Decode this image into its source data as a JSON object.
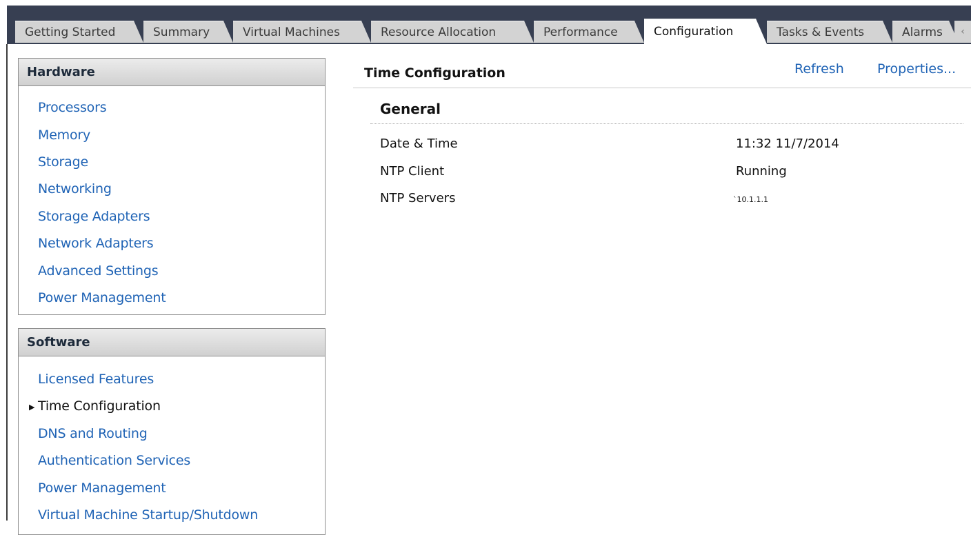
{
  "tabs": [
    {
      "label": "Getting Started",
      "active": false
    },
    {
      "label": "Summary",
      "active": false
    },
    {
      "label": "Virtual Machines",
      "active": false
    },
    {
      "label": "Resource Allocation",
      "active": false
    },
    {
      "label": "Performance",
      "active": false
    },
    {
      "label": "Configuration",
      "active": true
    },
    {
      "label": "Tasks & Events",
      "active": false
    },
    {
      "label": "Alarms",
      "active": false
    }
  ],
  "hardware": {
    "title": "Hardware",
    "items": [
      "Processors",
      "Memory",
      "Storage",
      "Networking",
      "Storage Adapters",
      "Network Adapters",
      "Advanced Settings",
      "Power Management"
    ]
  },
  "software": {
    "title": "Software",
    "items": [
      "Licensed Features",
      "Time Configuration",
      "DNS and Routing",
      "Authentication Services",
      "Power Management",
      "Virtual Machine Startup/Shutdown"
    ],
    "selected": "Time Configuration"
  },
  "content": {
    "title": "Time Configuration",
    "refresh_label": "Refresh",
    "properties_label": "Properties...",
    "section_title": "General",
    "rows": [
      {
        "label": "Date & Time",
        "value": "11:32  11/7/2014"
      },
      {
        "label": "NTP Client",
        "value": "Running"
      },
      {
        "label": "NTP Servers",
        "value": "`10.1.1.1"
      }
    ]
  },
  "colors": {
    "link": "#1f63b5",
    "tabbar_bg": "#373f52",
    "tab_bg": "#d3d3d3"
  }
}
